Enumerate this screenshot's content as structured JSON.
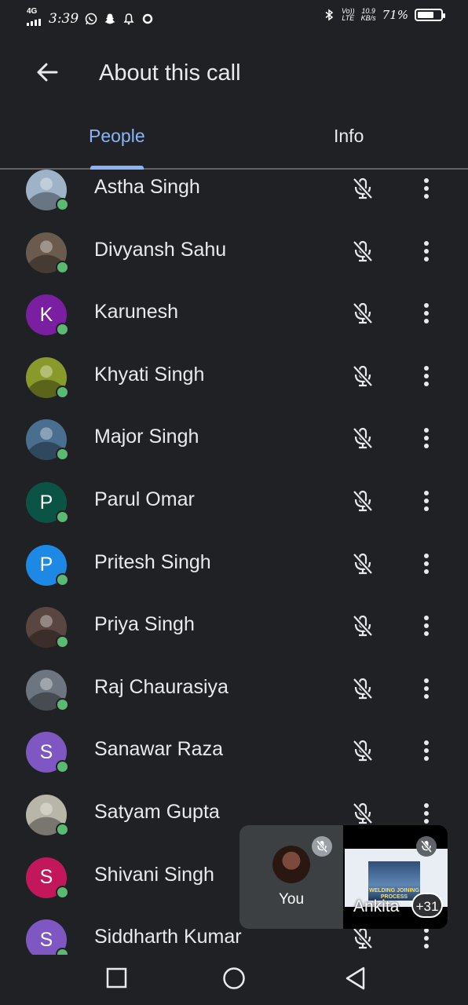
{
  "status_bar": {
    "network": "4G",
    "time": "3:39",
    "volte": "Vo))\nLTE",
    "speed_value": "10.9",
    "speed_unit": "KB/s",
    "battery_pct": "71%",
    "battery_level": 0.71
  },
  "header": {
    "title": "About this call"
  },
  "tabs": [
    {
      "label": "People",
      "selected": true
    },
    {
      "label": "Info",
      "selected": false
    }
  ],
  "participants": [
    {
      "name": "Astha Singh",
      "avatar_letter": "",
      "avatar_color": "#9fb3c8",
      "online": true,
      "muted": true
    },
    {
      "name": "Divyansh Sahu",
      "avatar_letter": "",
      "avatar_color": "#6b5b4e",
      "online": true,
      "muted": true
    },
    {
      "name": "Karunesh",
      "avatar_letter": "K",
      "avatar_color": "#7b1fa2",
      "online": true,
      "muted": true
    },
    {
      "name": "Khyati Singh",
      "avatar_letter": "",
      "avatar_color": "#8a9a2a",
      "online": true,
      "muted": true
    },
    {
      "name": "Major Singh",
      "avatar_letter": "",
      "avatar_color": "#4a6e8f",
      "online": true,
      "muted": true
    },
    {
      "name": "Parul Omar",
      "avatar_letter": "P",
      "avatar_color": "#0b5345",
      "online": true,
      "muted": true
    },
    {
      "name": "Pritesh Singh",
      "avatar_letter": "P",
      "avatar_color": "#1e88e5",
      "online": true,
      "muted": true
    },
    {
      "name": "Priya Singh",
      "avatar_letter": "",
      "avatar_color": "#5a4640",
      "online": true,
      "muted": true
    },
    {
      "name": "Raj Chaurasiya",
      "avatar_letter": "",
      "avatar_color": "#6d7580",
      "online": true,
      "muted": true
    },
    {
      "name": "Sanawar Raza",
      "avatar_letter": "S",
      "avatar_color": "#7e57c2",
      "online": true,
      "muted": true
    },
    {
      "name": "Satyam Gupta",
      "avatar_letter": "",
      "avatar_color": "#b8b6a8",
      "online": true,
      "muted": true
    },
    {
      "name": "Shivani Singh",
      "avatar_letter": "S",
      "avatar_color": "#c2185b",
      "online": true,
      "muted": true
    },
    {
      "name": "Siddharth Kumar",
      "avatar_letter": "S",
      "avatar_color": "#7e57c2",
      "online": true,
      "muted": true
    }
  ],
  "pip": {
    "self_label": "You",
    "other_label": "Ankita",
    "more_count": "+31",
    "slide_caption": "WELDING JOINING\nPROCESS"
  },
  "colors": {
    "background": "#202124",
    "accent": "#8ab4f8",
    "online": "#5bb974",
    "text": "#e8eaed"
  },
  "icons": {
    "back": "arrow-left-icon",
    "mic_off": "mic-off-icon",
    "more": "more-vert-icon",
    "nav_recents": "square-icon",
    "nav_home": "circle-icon",
    "nav_back": "triangle-back-icon"
  }
}
